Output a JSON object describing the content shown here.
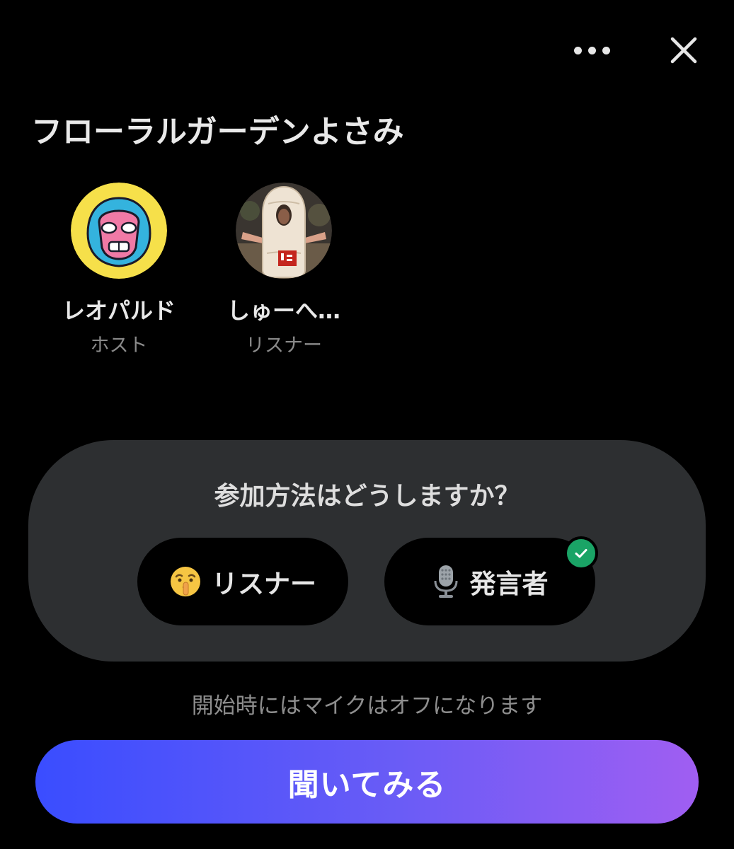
{
  "header": {
    "more_icon": "more-horizontal-icon",
    "close_icon": "close-icon"
  },
  "space": {
    "title": "フローラルガーデンよさみ"
  },
  "participants": [
    {
      "name": "レオパルド",
      "role": "ホスト",
      "avatar": "wrestler-mask-avatar"
    },
    {
      "name": "しゅーへ…",
      "role": "リスナー",
      "avatar": "rice-cracker-costume-avatar"
    }
  ],
  "join": {
    "question": "参加方法はどうしますか？",
    "options": [
      {
        "label": "リスナー",
        "icon": "shushing-face-icon",
        "selected": false
      },
      {
        "label": "発言者",
        "icon": "microphone-icon",
        "selected": true
      }
    ]
  },
  "note": "開始時にはマイクはオフになります",
  "primary_button": {
    "label": "聞いてみる"
  },
  "colors": {
    "background": "#000000",
    "panel": "#2d2f31",
    "check": "#1aa466",
    "gradient_start": "#3a4dff",
    "gradient_end": "#a05ef2"
  }
}
